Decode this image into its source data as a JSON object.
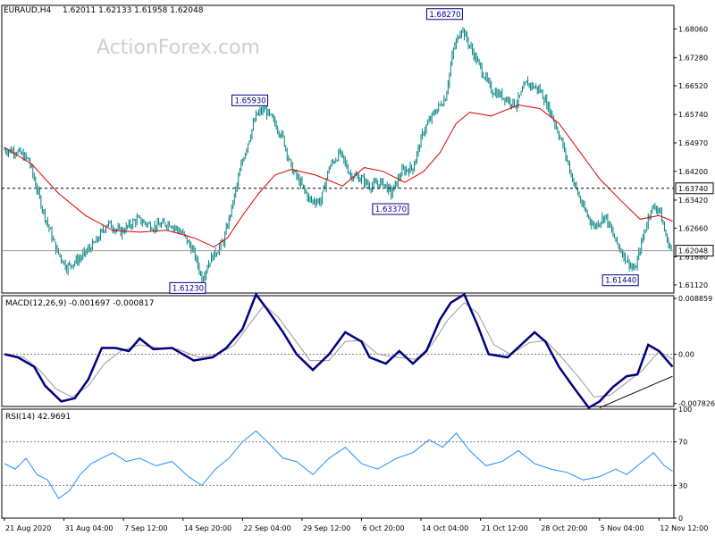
{
  "header": {
    "symbol": "EURAUD,H4",
    "ohlc": "1.62011 1.62133 1.61958 1.62048"
  },
  "watermark": "ActionForex.com",
  "colors": {
    "background": "#ffffff",
    "frame": "#000000",
    "candle": "#008080",
    "ma": "#dd0000",
    "macd_line": "#000080",
    "macd_signal": "#999999",
    "rsi_line": "#1e90ff",
    "grid": "#808080",
    "watermark": "#cfcfcf"
  },
  "chart_data": [
    {
      "type": "candlestick",
      "panel": "price",
      "ylim": [
        1.609,
        1.687
      ],
      "y_ticks": [
        "1.68060",
        "1.67280",
        "1.66520",
        "1.65740",
        "1.64970",
        "1.64200",
        "1.63420",
        "1.62660",
        "1.61880",
        "1.61120"
      ],
      "y_tick_values": [
        1.6806,
        1.6728,
        1.6652,
        1.6574,
        1.6497,
        1.642,
        1.6342,
        1.6266,
        1.6188,
        1.6112
      ],
      "x_labels": [
        "21 Aug 2020",
        "31 Aug 04:00",
        "7 Sep 12:00",
        "14 Sep 20:00",
        "22 Sep 04:00",
        "29 Sep 12:00",
        "6 Oct 20:00",
        "14 Oct 04:00",
        "21 Oct 12:00",
        "28 Oct 20:00",
        "5 Nov 04:00",
        "12 Nov 12:00"
      ],
      "x_label_bars": [
        0,
        44,
        88,
        132,
        176,
        220,
        264,
        308,
        352,
        396,
        440,
        484
      ],
      "bars": 494,
      "close_path": [
        [
          0,
          1.6478
        ],
        [
          9,
          1.6475
        ],
        [
          18,
          1.645
        ],
        [
          28,
          1.632
        ],
        [
          38,
          1.621
        ],
        [
          46,
          1.616
        ],
        [
          56,
          1.6185
        ],
        [
          68,
          1.623
        ],
        [
          76,
          1.628
        ],
        [
          86,
          1.6255
        ],
        [
          98,
          1.629
        ],
        [
          110,
          1.627
        ],
        [
          122,
          1.628
        ],
        [
          132,
          1.625
        ],
        [
          140,
          1.62
        ],
        [
          146,
          1.613
        ],
        [
          152,
          1.618
        ],
        [
          162,
          1.623
        ],
        [
          168,
          1.632
        ],
        [
          176,
          1.645
        ],
        [
          186,
          1.657
        ],
        [
          192,
          1.659
        ],
        [
          200,
          1.655
        ],
        [
          206,
          1.651
        ],
        [
          212,
          1.643
        ],
        [
          220,
          1.638
        ],
        [
          226,
          1.634
        ],
        [
          234,
          1.634
        ],
        [
          240,
          1.643
        ],
        [
          248,
          1.647
        ],
        [
          256,
          1.641
        ],
        [
          264,
          1.64
        ],
        [
          270,
          1.638
        ],
        [
          280,
          1.639
        ],
        [
          286,
          1.636
        ],
        [
          294,
          1.642
        ],
        [
          302,
          1.643
        ],
        [
          310,
          1.653
        ],
        [
          318,
          1.658
        ],
        [
          326,
          1.662
        ],
        [
          332,
          1.675
        ],
        [
          338,
          1.681
        ],
        [
          344,
          1.676
        ],
        [
          352,
          1.67
        ],
        [
          360,
          1.664
        ],
        [
          370,
          1.662
        ],
        [
          378,
          1.66
        ],
        [
          386,
          1.666
        ],
        [
          396,
          1.664
        ],
        [
          404,
          1.658
        ],
        [
          412,
          1.65
        ],
        [
          420,
          1.64
        ],
        [
          428,
          1.632
        ],
        [
          436,
          1.627
        ],
        [
          444,
          1.63
        ],
        [
          452,
          1.623
        ],
        [
          460,
          1.618
        ],
        [
          466,
          1.615
        ],
        [
          472,
          1.624
        ],
        [
          478,
          1.632
        ],
        [
          484,
          1.632
        ],
        [
          490,
          1.623
        ],
        [
          494,
          1.6205
        ]
      ],
      "ma_path": [
        [
          0,
          1.6485
        ],
        [
          20,
          1.644
        ],
        [
          40,
          1.636
        ],
        [
          60,
          1.63
        ],
        [
          80,
          1.626
        ],
        [
          100,
          1.6255
        ],
        [
          120,
          1.626
        ],
        [
          140,
          1.624
        ],
        [
          155,
          1.6215
        ],
        [
          165,
          1.624
        ],
        [
          176,
          1.63
        ],
        [
          188,
          1.636
        ],
        [
          200,
          1.641
        ],
        [
          212,
          1.6425
        ],
        [
          230,
          1.641
        ],
        [
          250,
          1.638
        ],
        [
          266,
          1.643
        ],
        [
          280,
          1.642
        ],
        [
          296,
          1.639
        ],
        [
          310,
          1.642
        ],
        [
          322,
          1.647
        ],
        [
          334,
          1.655
        ],
        [
          344,
          1.658
        ],
        [
          360,
          1.657
        ],
        [
          380,
          1.66
        ],
        [
          396,
          1.659
        ],
        [
          410,
          1.655
        ],
        [
          426,
          1.647
        ],
        [
          440,
          1.64
        ],
        [
          456,
          1.634
        ],
        [
          470,
          1.629
        ],
        [
          484,
          1.63
        ],
        [
          494,
          1.6285
        ]
      ],
      "levels": [
        {
          "label": "1.63740",
          "value": 1.6374,
          "style": "dashed"
        },
        {
          "label": "1.62048",
          "value": 1.62048,
          "style": "solid"
        }
      ],
      "annotations": [
        {
          "label": "1.68270",
          "bar": 336,
          "value": 1.6827
        },
        {
          "label": "1.65930",
          "bar": 192,
          "value": 1.6593
        },
        {
          "label": "1.63370",
          "bar": 296,
          "value": 1.6337
        },
        {
          "label": "1.61230",
          "bar": 146,
          "value": 1.6123
        },
        {
          "label": "1.61440",
          "bar": 466,
          "value": 1.6144
        }
      ]
    },
    {
      "type": "line",
      "panel": "macd",
      "title": "MACD(12,26,9) -0.001697 -0.000817",
      "ylim": [
        -0.0083,
        0.0093
      ],
      "y_ticks": [
        "0.008859",
        "0.00",
        "-0.007826"
      ],
      "y_tick_values": [
        0.008859,
        0.0,
        -0.007826
      ],
      "macd_path": [
        [
          0,
          0.0
        ],
        [
          10,
          -0.0005
        ],
        [
          22,
          -0.002
        ],
        [
          30,
          -0.005
        ],
        [
          42,
          -0.0075
        ],
        [
          52,
          -0.007
        ],
        [
          62,
          -0.004
        ],
        [
          72,
          0.001
        ],
        [
          82,
          0.001
        ],
        [
          92,
          0.0005
        ],
        [
          100,
          0.0025
        ],
        [
          110,
          0.0008
        ],
        [
          124,
          0.001
        ],
        [
          140,
          -0.001
        ],
        [
          154,
          -0.0005
        ],
        [
          164,
          0.001
        ],
        [
          176,
          0.004
        ],
        [
          186,
          0.0095
        ],
        [
          194,
          0.0072
        ],
        [
          206,
          0.0035
        ],
        [
          216,
          0.0
        ],
        [
          228,
          -0.0025
        ],
        [
          240,
          0.0
        ],
        [
          252,
          0.0035
        ],
        [
          264,
          0.002
        ],
        [
          270,
          -0.0005
        ],
        [
          282,
          -0.0015
        ],
        [
          292,
          0.0005
        ],
        [
          302,
          -0.0015
        ],
        [
          312,
          0.0005
        ],
        [
          322,
          0.0055
        ],
        [
          330,
          0.0082
        ],
        [
          340,
          0.0095
        ],
        [
          350,
          0.0045
        ],
        [
          358,
          0.0
        ],
        [
          372,
          -0.0005
        ],
        [
          382,
          0.0015
        ],
        [
          392,
          0.0035
        ],
        [
          400,
          0.002
        ],
        [
          410,
          -0.002
        ],
        [
          420,
          -0.005
        ],
        [
          432,
          -0.0085
        ],
        [
          440,
          -0.0075
        ],
        [
          450,
          -0.0052
        ],
        [
          460,
          -0.0035
        ],
        [
          468,
          -0.0032
        ],
        [
          476,
          0.0015
        ],
        [
          484,
          0.0005
        ],
        [
          494,
          -0.002
        ]
      ],
      "signal_path": [
        [
          0,
          0.0
        ],
        [
          14,
          -0.0005
        ],
        [
          26,
          -0.0025
        ],
        [
          38,
          -0.0055
        ],
        [
          50,
          -0.0068
        ],
        [
          62,
          -0.005
        ],
        [
          74,
          -0.0015
        ],
        [
          86,
          0.0005
        ],
        [
          100,
          0.0015
        ],
        [
          114,
          0.001
        ],
        [
          128,
          0.0008
        ],
        [
          144,
          -0.0005
        ],
        [
          158,
          0.0
        ],
        [
          170,
          0.0015
        ],
        [
          182,
          0.005
        ],
        [
          192,
          0.0078
        ],
        [
          202,
          0.006
        ],
        [
          214,
          0.0025
        ],
        [
          226,
          -0.001
        ],
        [
          240,
          -0.001
        ],
        [
          252,
          0.002
        ],
        [
          264,
          0.0022
        ],
        [
          276,
          0.0
        ],
        [
          290,
          -0.0005
        ],
        [
          304,
          -0.0008
        ],
        [
          316,
          0.0015
        ],
        [
          328,
          0.0055
        ],
        [
          340,
          0.0082
        ],
        [
          350,
          0.0065
        ],
        [
          362,
          0.0015
        ],
        [
          374,
          0.0
        ],
        [
          388,
          0.0018
        ],
        [
          400,
          0.0022
        ],
        [
          412,
          -0.0005
        ],
        [
          424,
          -0.0035
        ],
        [
          436,
          -0.0068
        ],
        [
          448,
          -0.0065
        ],
        [
          460,
          -0.0045
        ],
        [
          472,
          -0.0025
        ],
        [
          484,
          0.0005
        ],
        [
          494,
          -0.0008
        ]
      ],
      "trendline": [
        [
          440,
          -0.0085
        ],
        [
          494,
          -0.0035
        ]
      ]
    },
    {
      "type": "line",
      "panel": "rsi",
      "title": "RSI(14) 42.9691",
      "ylim": [
        0,
        100
      ],
      "y_ticks": [
        "100",
        "70",
        "30",
        "0"
      ],
      "y_tick_values": [
        100,
        70,
        30,
        0
      ],
      "levels": [
        70,
        30
      ],
      "rsi_path": [
        [
          0,
          50
        ],
        [
          8,
          45
        ],
        [
          16,
          55
        ],
        [
          24,
          40
        ],
        [
          32,
          35
        ],
        [
          40,
          18
        ],
        [
          48,
          25
        ],
        [
          56,
          40
        ],
        [
          64,
          50
        ],
        [
          72,
          55
        ],
        [
          80,
          60
        ],
        [
          90,
          52
        ],
        [
          100,
          55
        ],
        [
          112,
          48
        ],
        [
          124,
          52
        ],
        [
          136,
          38
        ],
        [
          146,
          30
        ],
        [
          156,
          45
        ],
        [
          166,
          55
        ],
        [
          176,
          70
        ],
        [
          186,
          80
        ],
        [
          196,
          68
        ],
        [
          206,
          55
        ],
        [
          216,
          52
        ],
        [
          228,
          40
        ],
        [
          240,
          55
        ],
        [
          252,
          65
        ],
        [
          264,
          50
        ],
        [
          276,
          45
        ],
        [
          290,
          55
        ],
        [
          302,
          60
        ],
        [
          314,
          72
        ],
        [
          324,
          65
        ],
        [
          334,
          78
        ],
        [
          344,
          62
        ],
        [
          356,
          48
        ],
        [
          368,
          52
        ],
        [
          380,
          62
        ],
        [
          392,
          50
        ],
        [
          404,
          45
        ],
        [
          416,
          42
        ],
        [
          428,
          35
        ],
        [
          440,
          38
        ],
        [
          452,
          45
        ],
        [
          460,
          40
        ],
        [
          470,
          50
        ],
        [
          480,
          60
        ],
        [
          488,
          48
        ],
        [
          494,
          43
        ]
      ]
    }
  ]
}
